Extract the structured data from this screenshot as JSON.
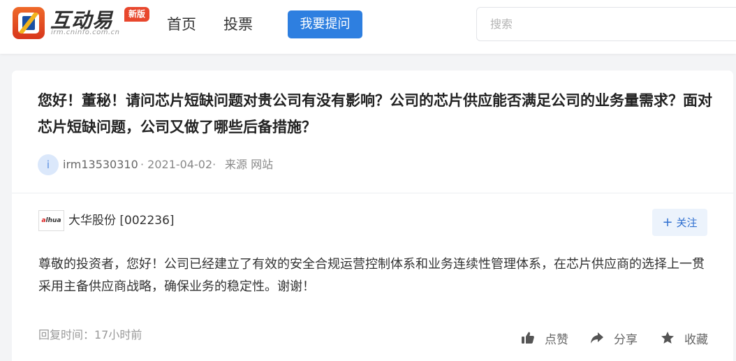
{
  "header": {
    "logo_title": "互动易",
    "logo_sub": "irm.cninfo.com.cn",
    "new_badge": "新版",
    "nav": [
      "首页",
      "投票"
    ],
    "ask_button": "我要提问",
    "search_placeholder": "搜索"
  },
  "question": {
    "text": "您好！董秘！请问芯片短缺问题对贵公司有没有影响？公司的芯片供应能否满足公司的业务量需求？面对芯片短缺问题，公司又做了哪些后备措施？",
    "asker_avatar": "i",
    "asker": "irm13530310",
    "date": "· 2021-04-02·",
    "source": "来源 网站"
  },
  "answer": {
    "company_logo_text": "alhua",
    "company": "大华股份 [002236]",
    "follow_button": "关注",
    "text": "尊敬的投资者，您好！公司已经建立了有效的安全合规运营控制体系和业务连续性管理体系，在芯片供应商的选择上一贯采用主备供应商战略，确保业务的稳定性。谢谢！",
    "reply_time": "回复时间：17小时前",
    "actions": {
      "like": "点赞",
      "share": "分享",
      "favorite": "收藏"
    }
  },
  "colors": {
    "accent": "#2e7fe0",
    "brand_orange": "#e8472d",
    "follow_bg": "#ecf3fc"
  }
}
